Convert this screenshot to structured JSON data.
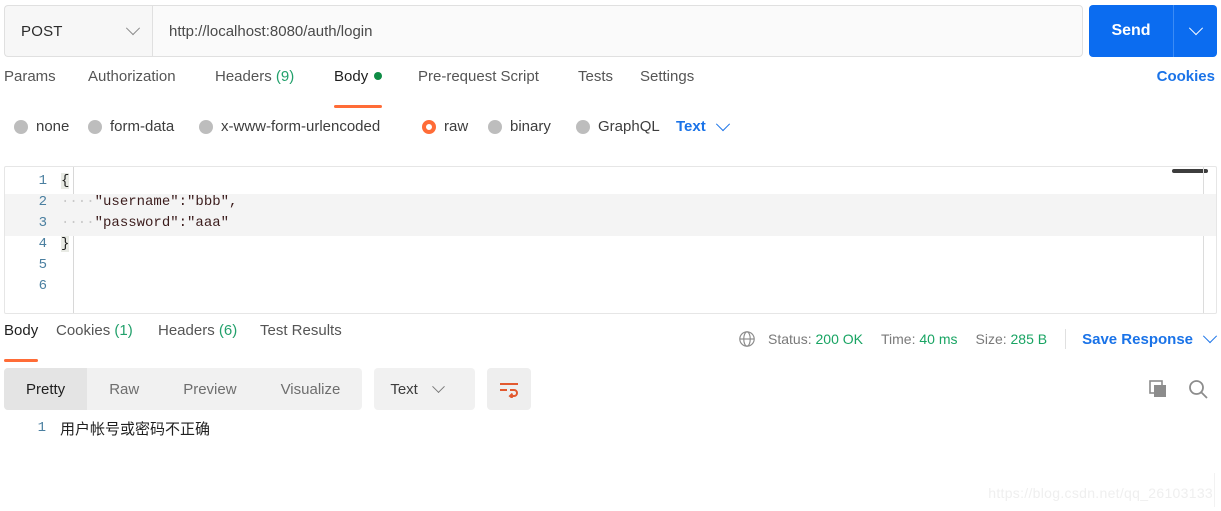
{
  "request": {
    "method": "POST",
    "url": "http://localhost:8080/auth/login",
    "send_label": "Send",
    "tabs": [
      {
        "label": "Params",
        "count": "",
        "active": false,
        "dot": false
      },
      {
        "label": "Authorization",
        "count": "",
        "active": false,
        "dot": false
      },
      {
        "label": "Headers",
        "count": "(9)",
        "active": false,
        "dot": false
      },
      {
        "label": "Body",
        "count": "",
        "active": true,
        "dot": true
      },
      {
        "label": "Pre-request Script",
        "count": "",
        "active": false,
        "dot": false
      },
      {
        "label": "Tests",
        "count": "",
        "active": false,
        "dot": false
      },
      {
        "label": "Settings",
        "count": "",
        "active": false,
        "dot": false
      }
    ],
    "cookies_link": "Cookies",
    "body_types": [
      {
        "label": "none",
        "selected": false
      },
      {
        "label": "form-data",
        "selected": false
      },
      {
        "label": "x-www-form-urlencoded",
        "selected": false
      },
      {
        "label": "raw",
        "selected": true
      },
      {
        "label": "binary",
        "selected": false
      },
      {
        "label": "GraphQL",
        "selected": false
      }
    ],
    "raw_format": "Text",
    "editor": {
      "lines": [
        {
          "n": "1",
          "open_brace": "{",
          "indent": "",
          "content": "",
          "highlight": false
        },
        {
          "n": "2",
          "open_brace": "",
          "indent": "····",
          "content": "\"username\":\"bbb\",",
          "highlight": true
        },
        {
          "n": "3",
          "open_brace": "",
          "indent": "····",
          "content": "\"password\":\"aaa\"",
          "highlight": true
        },
        {
          "n": "4",
          "open_brace": "}",
          "indent": "",
          "content": "",
          "highlight": false
        },
        {
          "n": "5",
          "open_brace": "",
          "indent": "",
          "content": "",
          "highlight": false
        },
        {
          "n": "6",
          "open_brace": "",
          "indent": "",
          "content": "",
          "highlight": false
        }
      ]
    }
  },
  "response": {
    "tabs": [
      {
        "label": "Body",
        "count": "",
        "active": true
      },
      {
        "label": "Cookies",
        "count": "(1)",
        "active": false
      },
      {
        "label": "Headers",
        "count": "(6)",
        "active": false
      },
      {
        "label": "Test Results",
        "count": "",
        "active": false
      }
    ],
    "status_label": "Status:",
    "status_value": "200 OK",
    "time_label": "Time:",
    "time_value": "40 ms",
    "size_label": "Size:",
    "size_value": "285 B",
    "save_response": "Save Response",
    "view_modes": [
      {
        "label": "Pretty",
        "active": true
      },
      {
        "label": "Raw",
        "active": false
      },
      {
        "label": "Preview",
        "active": false
      },
      {
        "label": "Visualize",
        "active": false
      }
    ],
    "format": "Text",
    "body_lines": [
      {
        "n": "1",
        "text": "用户帐号或密码不正确"
      }
    ]
  },
  "watermark": "https://blog.csdn.net/qq_26103133",
  "colors": {
    "accent_orange": "#ff6c37",
    "link_blue": "#1a73e8",
    "send_blue": "#0b6cf0",
    "success_green": "#19a463"
  }
}
